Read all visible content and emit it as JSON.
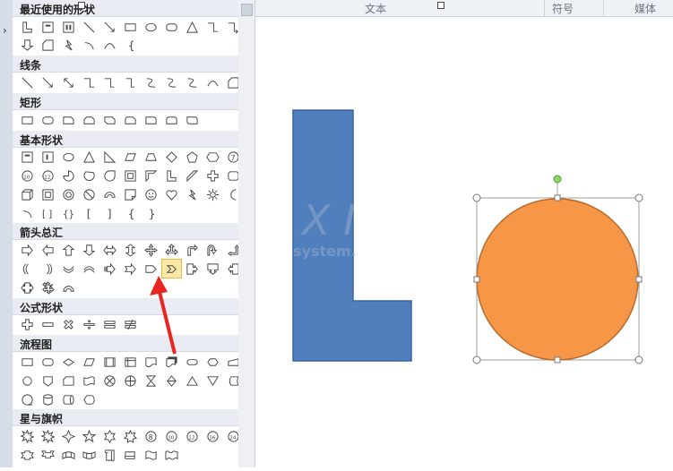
{
  "categories": [
    {
      "label": "最近使用的形状"
    },
    {
      "label": "线条"
    },
    {
      "label": "矩形"
    },
    {
      "label": "基本形状"
    },
    {
      "label": "箭头总汇"
    },
    {
      "label": "公式形状"
    },
    {
      "label": "流程图"
    },
    {
      "label": "星与旗帜"
    }
  ],
  "header_tabs": [
    "文本",
    "符号",
    "媒体"
  ],
  "watermark": {
    "big": "X I",
    "small": "system."
  },
  "colors": {
    "letter_shape": "#4f7fbd",
    "circle_fill": "#f79646",
    "circle_stroke": "#b66a2c",
    "arrow": "#e8251f",
    "selected_icon": "#fde9a5"
  },
  "canvas_shapes": [
    {
      "name": "letter-l-shape",
      "kind": "L-shape"
    },
    {
      "name": "orange-circle",
      "kind": "ellipse",
      "selected": true
    }
  ],
  "selected_gallery_icon": "chevron-arrow-icon",
  "scrollbar": {
    "arrow": "up"
  }
}
